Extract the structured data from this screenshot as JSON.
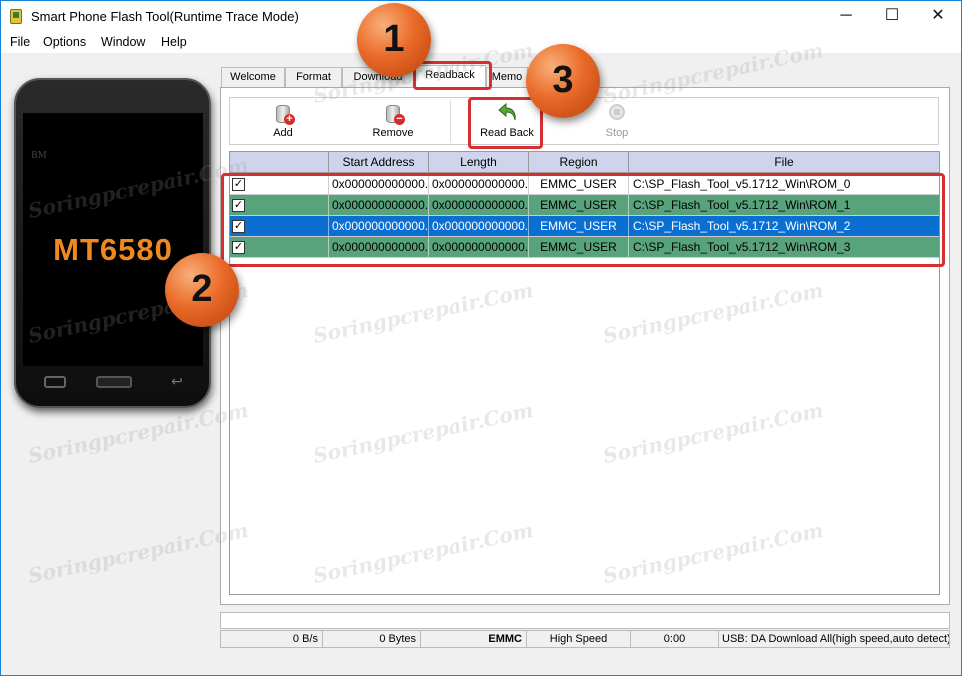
{
  "window": {
    "title": "Smart Phone Flash Tool(Runtime Trace Mode)",
    "controls": {
      "minimize": "─",
      "maximize": "☐",
      "close": "✕"
    }
  },
  "menu": [
    "File",
    "Options",
    "Window",
    "Help"
  ],
  "phone": {
    "brand": "BM",
    "model": "MT6580"
  },
  "tabs": [
    "Welcome",
    "Format",
    "Download",
    "Readback",
    "Memo"
  ],
  "toolbar": {
    "add": "Add",
    "remove": "Remove",
    "read_back": "Read Back",
    "stop": "Stop"
  },
  "table": {
    "columns": [
      "",
      "Start Address",
      "Length",
      "Region",
      "File"
    ],
    "rows": [
      {
        "checked": "✓",
        "start": "0x000000000000...",
        "length": "0x000000000000...",
        "region": "EMMC_USER",
        "file": "C:\\SP_Flash_Tool_v5.1712_Win\\ROM_0"
      },
      {
        "checked": "✓",
        "start": "0x000000000000...",
        "length": "0x000000000000...",
        "region": "EMMC_USER",
        "file": "C:\\SP_Flash_Tool_v5.1712_Win\\ROM_1"
      },
      {
        "checked": "✓",
        "start": "0x000000000000...",
        "length": "0x000000000000...",
        "region": "EMMC_USER",
        "file": "C:\\SP_Flash_Tool_v5.1712_Win\\ROM_2"
      },
      {
        "checked": "✓",
        "start": "0x000000000000...",
        "length": "0x000000000000...",
        "region": "EMMC_USER",
        "file": "C:\\SP_Flash_Tool_v5.1712_Win\\ROM_3"
      }
    ]
  },
  "status": {
    "speed": "0 B/s",
    "bytes": "0 Bytes",
    "storage": "EMMC",
    "mode": "High Speed",
    "time": "0:00",
    "usb": "USB: DA Download All(high speed,auto detect)"
  },
  "markers": [
    "1",
    "2",
    "3"
  ],
  "watermark": "Soringpcrepair.Com",
  "colors": {
    "accent_red": "#d72f2f",
    "row_green": "#58a27c",
    "row_selected": "#0a6fd0",
    "header": "#cfd4ec",
    "model_text": "#f08a1e"
  }
}
